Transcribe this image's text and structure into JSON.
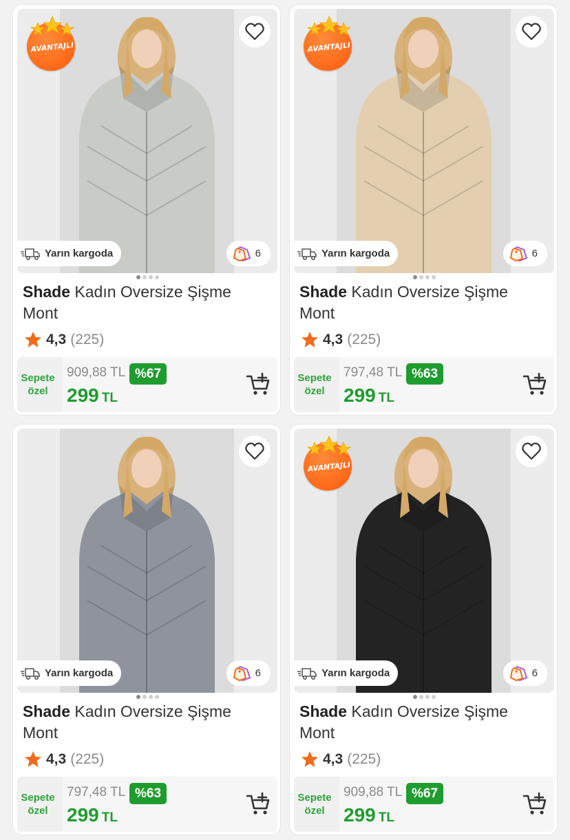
{
  "colors": {
    "accent_green": "#1f9c2f",
    "badge_orange": "#ff5a0a",
    "star_orange": "#f26a1b"
  },
  "products": [
    {
      "badge": "AVANTAJLI",
      "shipping": "Yarın kargoda",
      "variants": "6",
      "brand": "Shade",
      "name": " Kadın Oversize Şişme Mont",
      "rating": "4,3",
      "reviews": "(225)",
      "special_label_1": "Sepete",
      "special_label_2": "özel",
      "old_price": "909,88 TL",
      "discount": "%67",
      "price": "299",
      "currency": "TL",
      "jacket_color": "#c9cbc6"
    },
    {
      "badge": "AVANTAJLI",
      "shipping": "Yarın kargoda",
      "variants": "6",
      "brand": "Shade",
      "name": " Kadın Oversize Şişme Mont",
      "rating": "4,3",
      "reviews": "(225)",
      "special_label_1": "Sepete",
      "special_label_2": "özel",
      "old_price": "797,48 TL",
      "discount": "%63",
      "price": "299",
      "currency": "TL",
      "jacket_color": "#e3cfb0"
    },
    {
      "badge": "",
      "shipping": "Yarın kargoda",
      "variants": "6",
      "brand": "Shade",
      "name": " Kadın Oversize Şişme Mont",
      "rating": "4,3",
      "reviews": "(225)",
      "special_label_1": "Sepete",
      "special_label_2": "özel",
      "old_price": "797,48 TL",
      "discount": "%63",
      "price": "299",
      "currency": "TL",
      "jacket_color": "#8f949c"
    },
    {
      "badge": "AVANTAJLI",
      "shipping": "Yarın kargoda",
      "variants": "6",
      "brand": "Shade",
      "name": " Kadın Oversize Şişme Mont",
      "rating": "4,3",
      "reviews": "(225)",
      "special_label_1": "Sepete",
      "special_label_2": "özel",
      "old_price": "909,88 TL",
      "discount": "%67",
      "price": "299",
      "currency": "TL",
      "jacket_color": "#232323"
    }
  ]
}
